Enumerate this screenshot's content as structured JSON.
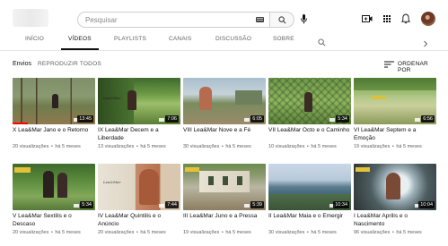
{
  "search": {
    "placeholder": "Pesquisar"
  },
  "tabs": [
    {
      "label": "INÍCIO"
    },
    {
      "label": "VÍDEOS"
    },
    {
      "label": "PLAYLISTS"
    },
    {
      "label": "CANAIS"
    },
    {
      "label": "DISCUSSÃO"
    },
    {
      "label": "SOBRE"
    }
  ],
  "section": {
    "title": "Envios",
    "play_all": "REPRODUZIR TODOS",
    "sort_label": "ORDENAR POR"
  },
  "videos": [
    {
      "title": "X Lea&Mar Jano e o Retorno",
      "views": "20 visualizações",
      "age": "há 5 meses",
      "duration": "13:45",
      "progress": 0.18
    },
    {
      "title": "IX Lea&Mar Decem e a Liberdade",
      "views": "13 visualizações",
      "age": "há 5 meses",
      "duration": "7:06",
      "progress": 0
    },
    {
      "title": "VIII Lea&Mar Nove e a Fé",
      "views": "30 visualizações",
      "age": "há 5 meses",
      "duration": "6:05",
      "progress": 0
    },
    {
      "title": "VII Lea&Mar Octo e o Caminho",
      "views": "10 visualizações",
      "age": "há 5 meses",
      "duration": "5:34",
      "progress": 0
    },
    {
      "title": "VI Lea&Mar Septem e a Emoção",
      "views": "19 visualizações",
      "age": "há 5 meses",
      "duration": "6:56",
      "progress": 0
    },
    {
      "title": "V Lea&Mar Sextilis e o Descaso",
      "views": "20 visualizações",
      "age": "há 5 meses",
      "duration": "5:34",
      "progress": 0
    },
    {
      "title": "IV Lea&Mar Quintilis e o Anúncio",
      "views": "20 visualizações",
      "age": "há 5 meses",
      "duration": "7:44",
      "progress": 0
    },
    {
      "title": "III Lea&Mar Juno e a Pressa",
      "views": "19 visualizações",
      "age": "há 5 meses",
      "duration": "5:39",
      "progress": 0
    },
    {
      "title": "II Lea&Mar Maia e o Emergir",
      "views": "30 visualizações",
      "age": "há 5 meses",
      "duration": "10:34",
      "progress": 0
    },
    {
      "title": "I Lea&Mar Aprilis e o Nascimento",
      "views": "96 visualizações",
      "age": "há 5 meses",
      "duration": "10:04",
      "progress": 0
    }
  ],
  "colors": {
    "progress": "#ff0000",
    "text": "#0f0f0f",
    "meta": "#606060"
  },
  "icons": [
    "keyboard-icon",
    "search-icon",
    "mic-icon",
    "create-video-icon",
    "apps-grid-icon",
    "bell-icon",
    "tab-search-icon",
    "chevron-right-icon",
    "sort-icon"
  ]
}
